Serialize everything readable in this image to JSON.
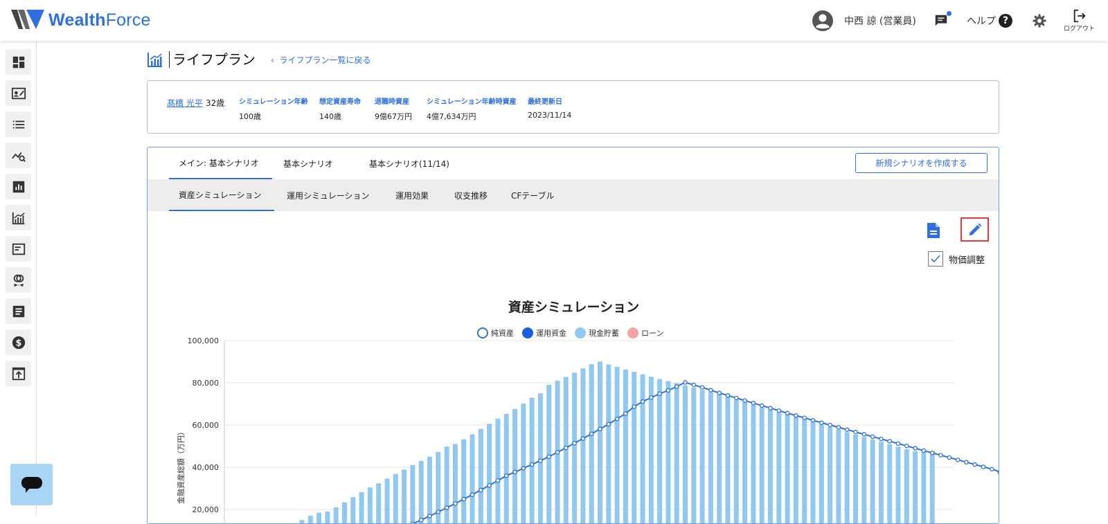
{
  "app": {
    "brand_primary": "Wealth",
    "brand_secondary": "Force",
    "accent_color": "#2f6fe0"
  },
  "header": {
    "user_name": "中西 諒 (営業員)",
    "help_label": "ヘルプ",
    "help_icon_glyph": "?",
    "logout_label": "ログアウト"
  },
  "sidebar": {
    "items": [
      {
        "icon": "dashboard-icon"
      },
      {
        "icon": "customer-card-icon"
      },
      {
        "icon": "list-icon"
      },
      {
        "icon": "analysis-search-icon"
      },
      {
        "icon": "bar-report-icon"
      },
      {
        "icon": "lifeplan-chart-icon"
      },
      {
        "icon": "document-window-icon"
      },
      {
        "icon": "rings-icon"
      },
      {
        "icon": "notes-icon"
      },
      {
        "icon": "dollar-icon"
      },
      {
        "icon": "upload-window-icon"
      }
    ],
    "chat_icon": "chat-bubble-icon"
  },
  "page": {
    "title": "ライフプラン",
    "back_link": "ライフプラン一覧に戻る"
  },
  "client": {
    "name": "髙橋 光平",
    "age": "32歳",
    "fields": [
      {
        "label": "シミュレーション年齢",
        "value": "100歳"
      },
      {
        "label": "想定資産寿命",
        "value": "140歳"
      },
      {
        "label": "退職時資産",
        "value": "9億67万円"
      },
      {
        "label": "シミュレーション年齢時資産",
        "value": "4億7,634万円"
      },
      {
        "label": "最終更新日",
        "value": "2023/11/14"
      }
    ]
  },
  "scenario_tabs": [
    "メイン: 基本シナリオ",
    "基本シナリオ",
    "基本シナリオ(11/14)"
  ],
  "new_scenario_button": "新規シナリオを作成する",
  "sub_tabs": [
    "資産シミュレーション",
    "運用シミュレーション",
    "運用効果",
    "収支推移",
    "CFテーブル"
  ],
  "price_adjust_label": "物価調整",
  "price_adjust_checked": true,
  "chart_data": {
    "type": "bar",
    "title": "資産シミュレーション",
    "ylabel": "金融資産総額（万円）",
    "ylim": [
      0,
      100000
    ],
    "yticks": [
      "100,000",
      "80,000",
      "60,000",
      "40,000",
      "20,000"
    ],
    "legend_position": "top",
    "series": [
      {
        "name": "純資産",
        "kind": "line",
        "color": "#2f6fe0",
        "values": [
          4200,
          6000,
          7800,
          9600,
          11400,
          13200,
          15000,
          16900,
          18800,
          20800,
          22800,
          24900,
          27000,
          29200,
          31400,
          33700,
          36000,
          37700,
          39500,
          41300,
          43100,
          45000,
          47100,
          49200,
          51400,
          53600,
          55800,
          58100,
          60400,
          62900,
          65400,
          68700,
          71100,
          73000,
          74800,
          76400,
          78200,
          80200,
          79000,
          77800,
          76500,
          75200,
          74000,
          72800,
          71600,
          70400,
          69200,
          68000,
          66800,
          65600,
          64500,
          63400,
          62200,
          61100,
          60000,
          58900,
          57800,
          56700,
          55600,
          54500,
          53400,
          52300,
          51200,
          50100,
          49000,
          47900,
          46800,
          45700,
          44600,
          43500,
          42400,
          41300,
          40200,
          39100,
          37700
        ],
        "visible_start": 13
      },
      {
        "name": "運用資金",
        "kind": "area",
        "color": "#1a5fe0",
        "values": []
      },
      {
        "name": "現金貯蓄",
        "kind": "bar",
        "color": "#90c8f0",
        "values": [
          5000,
          7000,
          9000,
          11000,
          13000,
          15000,
          17000,
          18500,
          19000,
          21000,
          23400,
          25800,
          28200,
          30400,
          32400,
          34600,
          36800,
          38900,
          41000,
          43000,
          45000,
          47200,
          49800,
          51000,
          53200,
          55600,
          58200,
          60600,
          63000,
          65300,
          67600,
          70200,
          73000,
          75000,
          79000,
          81000,
          82800,
          84800,
          86800,
          88800,
          90000,
          88700,
          87500,
          86300,
          85200,
          84000,
          82900,
          81800,
          80800,
          79800,
          78800,
          77700,
          76600,
          75500,
          74400,
          73200,
          72000,
          70800,
          69600,
          68400,
          67200,
          66000,
          64900,
          63800,
          62600,
          61400,
          60200,
          59000,
          57800,
          56600,
          55400,
          54300,
          53200,
          52100,
          50900,
          49700,
          48500,
          47600,
          47300,
          47600
        ]
      },
      {
        "name": "ローン",
        "kind": "bar",
        "color": "#f4a3a3",
        "values": []
      }
    ]
  }
}
